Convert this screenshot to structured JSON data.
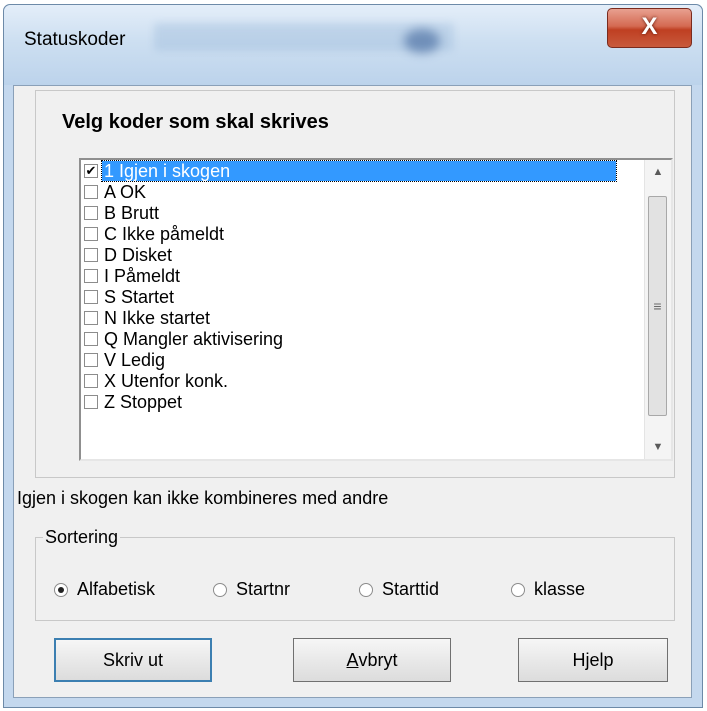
{
  "window": {
    "title": "Statuskoder",
    "close_glyph": "X"
  },
  "codes_group": {
    "title": "Velg koder som skal skrives",
    "items": [
      {
        "label": "1 Igjen i skogen",
        "checked": true,
        "selected": true
      },
      {
        "label": "A OK",
        "checked": false
      },
      {
        "label": "B Brutt",
        "checked": false
      },
      {
        "label": "C Ikke påmeldt",
        "checked": false
      },
      {
        "label": "D Disket",
        "checked": false
      },
      {
        "label": "I Påmeldt",
        "checked": false
      },
      {
        "label": "S Startet",
        "checked": false
      },
      {
        "label": "N Ikke startet",
        "checked": false
      },
      {
        "label": "Q Mangler aktivisering",
        "checked": false
      },
      {
        "label": "V Ledig",
        "checked": false
      },
      {
        "label": "X Utenfor konk.",
        "checked": false
      },
      {
        "label": "Z Stoppet",
        "checked": false
      }
    ],
    "scroll_up": "▲",
    "scroll_down": "▼",
    "thumb_grip": "≡"
  },
  "note": "Igjen i skogen kan ikke kombineres med andre",
  "sorting": {
    "legend": "Sortering",
    "options": [
      {
        "label": "Alfabetisk",
        "selected": true
      },
      {
        "label": "Startnr",
        "selected": false
      },
      {
        "label": "Starttid",
        "selected": false
      },
      {
        "label": "klasse",
        "selected": false
      }
    ]
  },
  "buttons": {
    "print": "Skriv ut",
    "cancel_accel": "A",
    "cancel_rest": "vbryt",
    "help": "Hjelp"
  },
  "check_glyph": "✔",
  "colors": {
    "selection": "#3399ff",
    "close_button": "#c8553a"
  }
}
